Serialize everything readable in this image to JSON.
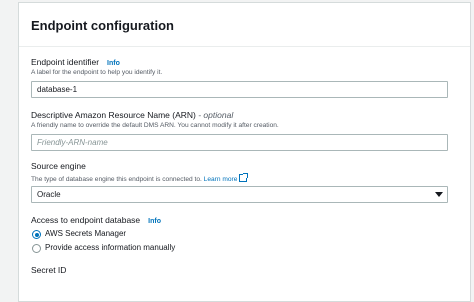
{
  "panel": {
    "title": "Endpoint configuration"
  },
  "endpoint_identifier": {
    "label": "Endpoint identifier",
    "info": "Info",
    "description": "A label for the endpoint to help you identify it.",
    "value": "database-1"
  },
  "arn": {
    "label": "Descriptive Amazon Resource Name (ARN)",
    "optional": "- optional",
    "description": "A friendly name to override the default DMS ARN. You cannot modify it after creation.",
    "placeholder": "Friendly-ARN-name"
  },
  "source_engine": {
    "label": "Source engine",
    "description": "The type of database engine this endpoint is connected to.",
    "learn_more": "Learn more",
    "selected": "Oracle"
  },
  "access": {
    "label": "Access to endpoint database",
    "info": "Info",
    "options": [
      {
        "label": "AWS Secrets Manager",
        "selected": true
      },
      {
        "label": "Provide access information manually",
        "selected": false
      }
    ]
  },
  "secret_id": {
    "label": "Secret ID"
  },
  "colors": {
    "accent": "#0073bb",
    "border": "#aab7b8",
    "background": "#f2f3f3"
  },
  "icons": [
    "external-link-icon",
    "caret-down-icon"
  ]
}
